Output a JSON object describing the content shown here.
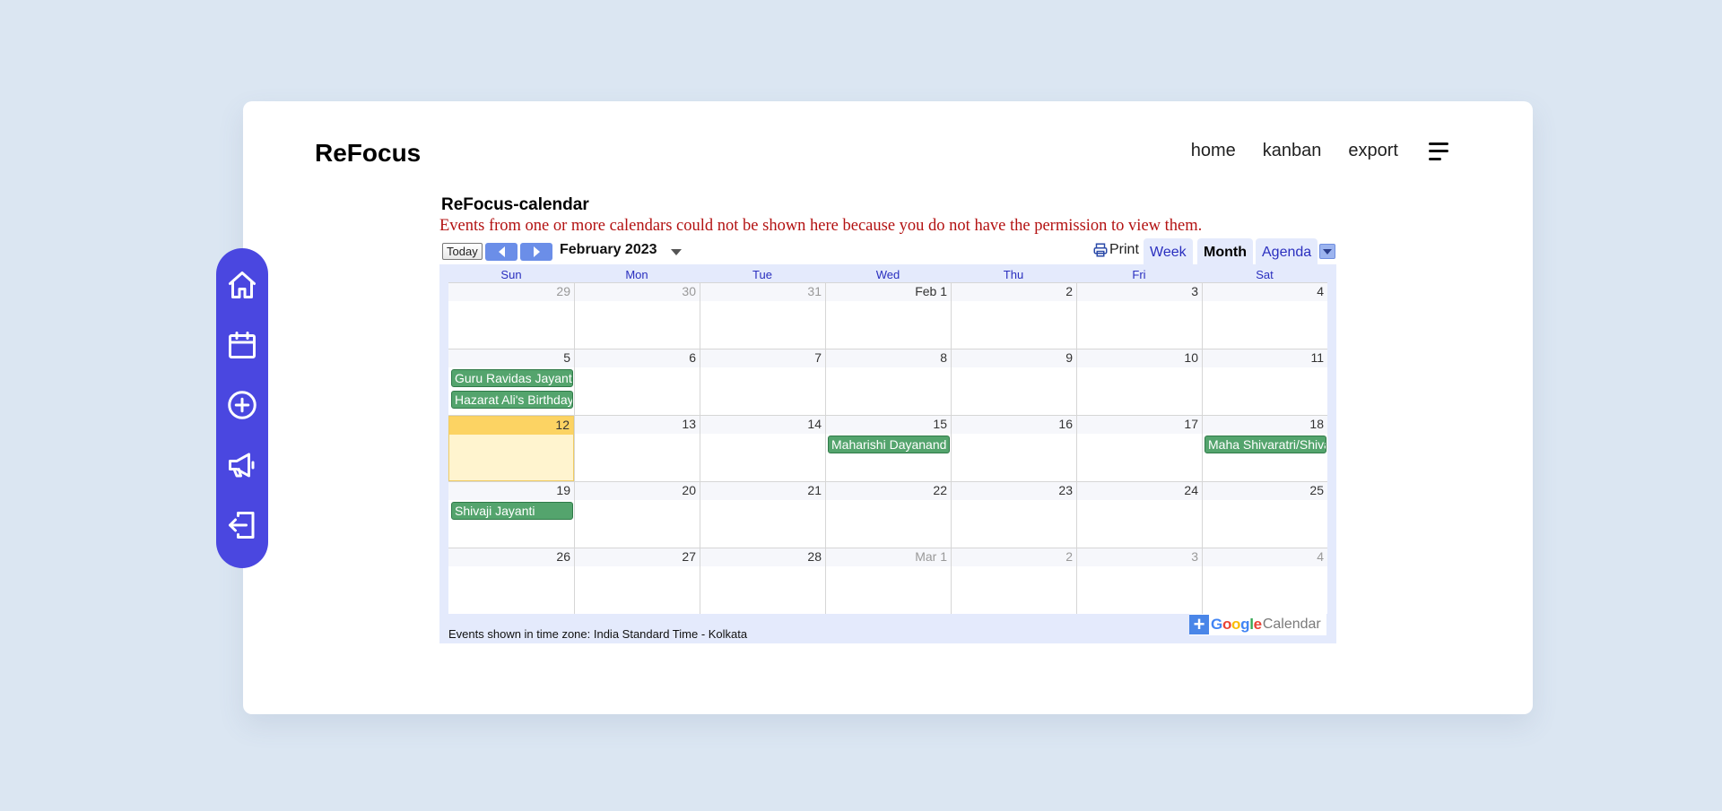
{
  "app": {
    "brand": "ReFocus",
    "nav": [
      "home",
      "kanban",
      "export"
    ]
  },
  "sidebar": {
    "items": [
      "home-icon",
      "calendar-icon",
      "plus-circle-icon",
      "megaphone-icon",
      "logout-icon"
    ]
  },
  "calendar": {
    "title": "ReFocus-calendar",
    "warning": "Events from one or more calendars could not be shown here because you do not have the permission to view them.",
    "today_label": "Today",
    "month_label": "February 2023",
    "print_label": "Print",
    "tabs": {
      "week": "Week",
      "month": "Month",
      "agenda": "Agenda"
    },
    "days_of_week": [
      "Sun",
      "Mon",
      "Tue",
      "Wed",
      "Thu",
      "Fri",
      "Sat"
    ],
    "weeks": [
      [
        "29",
        "30",
        "31",
        "Feb 1",
        "2",
        "3",
        "4"
      ],
      [
        "5",
        "6",
        "7",
        "8",
        "9",
        "10",
        "11"
      ],
      [
        "12",
        "13",
        "14",
        "15",
        "16",
        "17",
        "18"
      ],
      [
        "19",
        "20",
        "21",
        "22",
        "23",
        "24",
        "25"
      ],
      [
        "26",
        "27",
        "28",
        "Mar 1",
        "2",
        "3",
        "4"
      ]
    ],
    "events": [
      "Guru Ravidas Jayanti",
      "Hazarat Ali's Birthday",
      "Maharishi Dayanand Saraswati Jayanti",
      "Maha Shivaratri/Shivaratri",
      "Shivaji Jayanti"
    ],
    "timezone": "Events shown in time zone: India Standard Time - Kolkata",
    "badge": {
      "google": "Google",
      "calendar": "Calendar"
    }
  }
}
